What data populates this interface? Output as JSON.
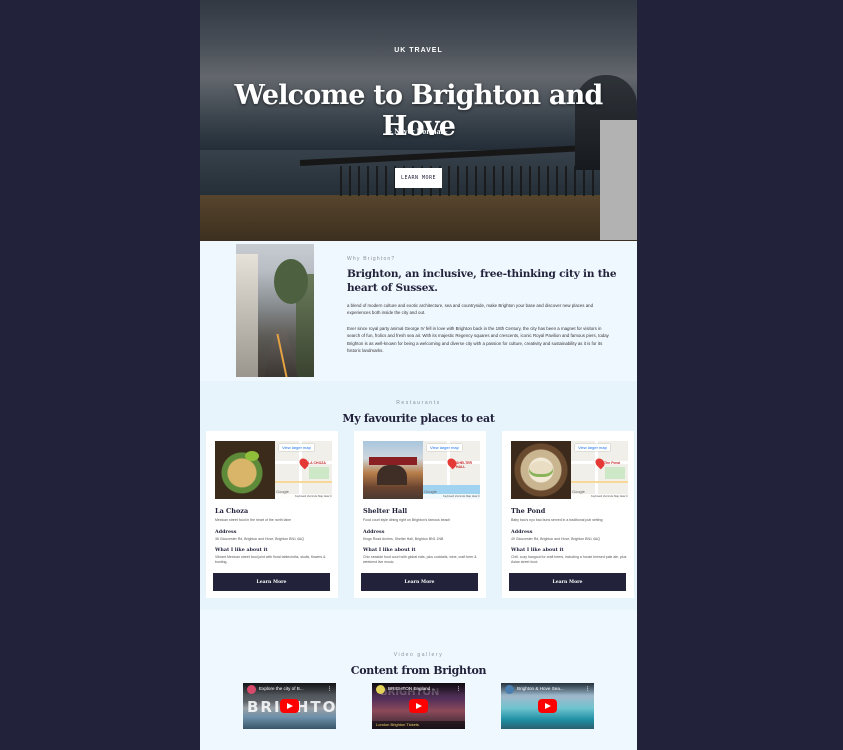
{
  "hero": {
    "eyebrow": "UK TRAVEL",
    "title": "Welcome to Brighton and Hove",
    "subtitle": "- Never Normal -",
    "button": "LEARN MORE"
  },
  "why": {
    "eyebrow": "Why Brighton?",
    "title": "Brighton, an inclusive, free-thinking city in the heart of Sussex.",
    "paragraphs": [
      "a blend of modern culture and exotic architecture, sea and countryside, make Brighton your base and discover new places and experiences both inside the city and out.",
      "Ever since royal party animal George IV fell in love with Brighton back in the 18th Century, the city has been a magnet for visitors in search of fun, frolics and fresh sea air. With its majestic Regency squares and crescents, iconic Royal Pavilion and famous piers, today Brighton is as well-known for being a welcoming and diverse city with a passion for culture, creativity and sustainability as it is for its historic landmarks."
    ]
  },
  "restaurants": {
    "eyebrow": "Restaurants",
    "title": "My favourite places to eat",
    "map_link": "View larger map",
    "map_attr": "Keyboard shortcuts  Map data ©2024  Terms",
    "map_google": "Google",
    "address_heading": "Address",
    "like_heading": "What I like about it",
    "button_label": "Learn More",
    "cards": [
      {
        "name": "La Choza",
        "pin": "LA CHOZA",
        "description": "Mexican street food in the heart of the north laine",
        "address": "36 Gloucester Rd, Brighton and Hove, Brighton BN1 4AQ",
        "like": "Vibrant Mexican street food joint with floral tablecloths, skulls, flowers & bunting."
      },
      {
        "name": "Shelter Hall",
        "pin": "SHELTER HALL",
        "description": "Food court style dining right on Brighton's famous beach",
        "address": "Kings Road Arches, Shelter Hall, Brighton BN1 1NB",
        "like": "Chic seaside food court with global eats, plus cocktails, wine, craft beer & weekend live music."
      },
      {
        "name": "The Pond",
        "pin": "The Pond",
        "description": "Baby bao's nyo bao buns served in a traditional pub setting",
        "address": "49 Gloucester Rd, Brighton and Hove, Brighton BN1 4AQ",
        "like": "Chill, cozy hangout for craft beers, including a house brewed pale ale, plus Asian street food."
      }
    ]
  },
  "videos": {
    "eyebrow": "Video gallery",
    "title": "Content from Brighton",
    "items": [
      {
        "title": "Explore the city of B...",
        "thumb_text": "BRIGHTON"
      },
      {
        "title": "BRIGHTON England ...",
        "thumb_text": "BRIGHTON",
        "ticket": "London Brighton Tickets"
      },
      {
        "title": "Brighton & Hove Sea...",
        "thumb_text": ""
      }
    ]
  },
  "colors": {
    "background": "#22223b",
    "page": "#f0f8ff",
    "section_alt": "#e8f4fc",
    "button_dark": "#22223b",
    "youtube_red": "#ff0000"
  },
  "icons": [
    "youtube-play-icon",
    "map-pin-icon",
    "video-menu-icon",
    "channel-avatar-icon"
  ]
}
